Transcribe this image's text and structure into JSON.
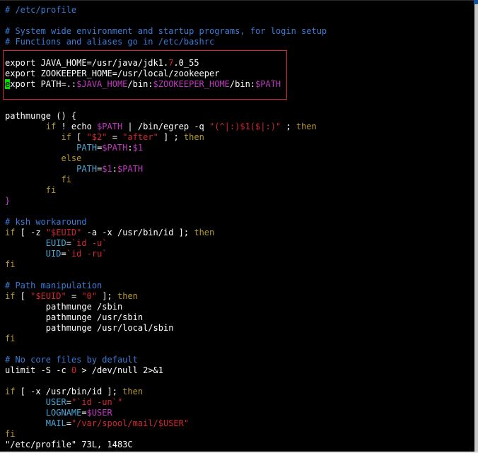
{
  "colors": {
    "default": "#ffffff",
    "comment": "#3a7bd5",
    "keyword": "#b79a2a",
    "identifier": "#4aa8d8",
    "variable": "#c238c2",
    "string": "#d2282e",
    "cursor": "#00e000",
    "highlight_box": "#e0232b"
  },
  "editor": {
    "file_name": "/etc/profile",
    "cursor_line": 6,
    "lines": [
      [
        [
          "comment",
          "# /etc/profile"
        ]
      ],
      [],
      [
        [
          "comment",
          "# System wide environment and startup programs, for login setup"
        ]
      ],
      [
        [
          "comment",
          "# Functions and aliases go in /etc/bashrc"
        ]
      ],
      [],
      [
        [
          "default",
          "export JAVA_HOME=/usr/java/jdk1."
        ],
        [
          "string",
          "7"
        ],
        [
          "default",
          ".0_55"
        ]
      ],
      [
        [
          "default",
          "export ZOOKEEPER_HOME=/usr/local/zookeeper"
        ]
      ],
      [
        [
          "cursor",
          "e"
        ],
        [
          "default",
          "xport PATH=.:"
        ],
        [
          "variable",
          "$JAVA_HOME"
        ],
        [
          "default",
          "/bin:"
        ],
        [
          "variable",
          "$ZOOKEEPER_HOME"
        ],
        [
          "default",
          "/bin:"
        ],
        [
          "variable",
          "$PATH"
        ]
      ],
      [],
      [],
      [
        [
          "default",
          "pathmunge () {"
        ]
      ],
      [
        [
          "default",
          "        "
        ],
        [
          "keyword",
          "if"
        ],
        [
          "default",
          " ! echo "
        ],
        [
          "variable",
          "$PATH"
        ],
        [
          "default",
          " | /bin/egrep -q "
        ],
        [
          "string",
          "\"(^|:)$1($|:)\""
        ],
        [
          "default",
          " ; "
        ],
        [
          "keyword",
          "then"
        ]
      ],
      [
        [
          "default",
          "           "
        ],
        [
          "keyword",
          "if"
        ],
        [
          "default",
          " [ "
        ],
        [
          "string",
          "\"$2\""
        ],
        [
          "default",
          " = "
        ],
        [
          "string",
          "\"after\""
        ],
        [
          "default",
          " ] ; "
        ],
        [
          "keyword",
          "then"
        ]
      ],
      [
        [
          "default",
          "              "
        ],
        [
          "identifier",
          "PATH"
        ],
        [
          "default",
          "="
        ],
        [
          "variable",
          "$PATH"
        ],
        [
          "default",
          ":"
        ],
        [
          "variable",
          "$1"
        ]
      ],
      [
        [
          "default",
          "           "
        ],
        [
          "keyword",
          "else"
        ]
      ],
      [
        [
          "default",
          "              "
        ],
        [
          "identifier",
          "PATH"
        ],
        [
          "default",
          "="
        ],
        [
          "variable",
          "$1"
        ],
        [
          "default",
          ":"
        ],
        [
          "variable",
          "$PATH"
        ]
      ],
      [
        [
          "default",
          "           "
        ],
        [
          "keyword",
          "fi"
        ]
      ],
      [
        [
          "default",
          "        "
        ],
        [
          "keyword",
          "fi"
        ]
      ],
      [
        [
          "variable",
          "}"
        ]
      ],
      [],
      [
        [
          "comment",
          "# ksh workaround"
        ]
      ],
      [
        [
          "keyword",
          "if"
        ],
        [
          "default",
          " [ -z "
        ],
        [
          "string",
          "\"$EUID\""
        ],
        [
          "default",
          " -a -x /usr/bin/id ]; "
        ],
        [
          "keyword",
          "then"
        ]
      ],
      [
        [
          "default",
          "        "
        ],
        [
          "identifier",
          "EUID"
        ],
        [
          "default",
          "="
        ],
        [
          "string",
          "`id -u`"
        ]
      ],
      [
        [
          "default",
          "        "
        ],
        [
          "identifier",
          "UID"
        ],
        [
          "default",
          "="
        ],
        [
          "string",
          "`id -ru`"
        ]
      ],
      [
        [
          "keyword",
          "fi"
        ]
      ],
      [],
      [
        [
          "comment",
          "# Path manipulation"
        ]
      ],
      [
        [
          "keyword",
          "if"
        ],
        [
          "default",
          " [ "
        ],
        [
          "string",
          "\"$EUID\""
        ],
        [
          "default",
          " = "
        ],
        [
          "string",
          "\"0\""
        ],
        [
          "default",
          " ]; "
        ],
        [
          "keyword",
          "then"
        ]
      ],
      [
        [
          "default",
          "        pathmunge /sbin"
        ]
      ],
      [
        [
          "default",
          "        pathmunge /usr/sbin"
        ]
      ],
      [
        [
          "default",
          "        pathmunge /usr/local/sbin"
        ]
      ],
      [
        [
          "keyword",
          "fi"
        ]
      ],
      [],
      [
        [
          "comment",
          "# No core files by default"
        ]
      ],
      [
        [
          "default",
          "ulimit -S -c "
        ],
        [
          "string",
          "0"
        ],
        [
          "default",
          " > /dev/null 2>&1"
        ]
      ],
      [],
      [
        [
          "keyword",
          "if"
        ],
        [
          "default",
          " [ -x /usr/bin/id ]; "
        ],
        [
          "keyword",
          "then"
        ]
      ],
      [
        [
          "default",
          "        "
        ],
        [
          "identifier",
          "USER"
        ],
        [
          "default",
          "="
        ],
        [
          "string",
          "\"`id -un`\""
        ]
      ],
      [
        [
          "default",
          "        "
        ],
        [
          "identifier",
          "LOGNAME"
        ],
        [
          "default",
          "="
        ],
        [
          "variable",
          "$USER"
        ]
      ],
      [
        [
          "default",
          "        "
        ],
        [
          "identifier",
          "MAIL"
        ],
        [
          "default",
          "="
        ],
        [
          "string",
          "\"/var/spool/mail/$USER\""
        ]
      ],
      [
        [
          "keyword",
          "fi"
        ]
      ]
    ],
    "status_line": "\"/etc/profile\" 73L, 1483C"
  }
}
